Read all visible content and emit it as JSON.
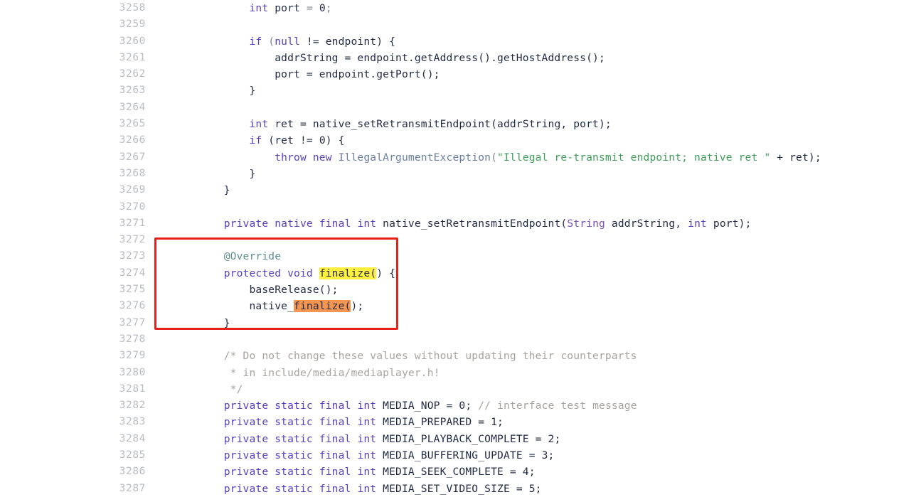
{
  "viewer": {
    "name": "code-file-viewer",
    "language": "Java",
    "first_line": 3258,
    "last_line": 3287
  },
  "annotation": {
    "type": "rectangle",
    "color": "#e8201a",
    "covers_lines": [
      3273,
      3277
    ],
    "label": "finalize-method-callout"
  },
  "highlights": [
    {
      "text": "finalize(",
      "color": "#ffef3f",
      "line": 3274,
      "name": "search-match-primary"
    },
    {
      "text": "finalize(",
      "color": "#f59552",
      "line": 3276,
      "name": "search-match-selected"
    }
  ],
  "colors": {
    "background": "#ffffff",
    "line_number": "#b9bdc4",
    "text": "#1f2a44",
    "keyword": "#5b3fbf",
    "type": "#7a4fbf",
    "class_name": "#6b7f9e",
    "string": "#3f9e5a",
    "comment": "#a8a49c",
    "annotation_token": "#5f8f92",
    "highlight_yellow": "#ffef3f",
    "highlight_orange": "#f59552",
    "callout_red": "#e8201a"
  },
  "lines": [
    {
      "number": "3258",
      "tokens": [
        {
          "t": "        ",
          "c": "plain"
        },
        {
          "t": "int",
          "c": "kw"
        },
        {
          "t": " port ",
          "c": "plain"
        },
        {
          "t": "=",
          "c": "punct"
        },
        {
          "t": " ",
          "c": "plain"
        },
        {
          "t": "0",
          "c": "num"
        },
        {
          "t": ";",
          "c": "punct"
        }
      ]
    },
    {
      "number": "3259",
      "tokens": []
    },
    {
      "number": "3260",
      "tokens": [
        {
          "t": "        ",
          "c": "plain"
        },
        {
          "t": "if",
          "c": "kw"
        },
        {
          "t": " (",
          "c": "punct"
        },
        {
          "t": "null",
          "c": "kw"
        },
        {
          "t": " != endpoint) {",
          "c": "plain"
        }
      ]
    },
    {
      "number": "3261",
      "tokens": [
        {
          "t": "            addrString = endpoint.getAddress().getHostAddress();",
          "c": "plain"
        }
      ]
    },
    {
      "number": "3262",
      "tokens": [
        {
          "t": "            port = endpoint.getPort();",
          "c": "plain"
        }
      ]
    },
    {
      "number": "3263",
      "tokens": [
        {
          "t": "        }",
          "c": "plain"
        }
      ]
    },
    {
      "number": "3264",
      "tokens": []
    },
    {
      "number": "3265",
      "tokens": [
        {
          "t": "        ",
          "c": "plain"
        },
        {
          "t": "int",
          "c": "kw"
        },
        {
          "t": " ret = native_setRetransmitEndpoint(addrString, port);",
          "c": "plain"
        }
      ]
    },
    {
      "number": "3266",
      "tokens": [
        {
          "t": "        ",
          "c": "plain"
        },
        {
          "t": "if",
          "c": "kw"
        },
        {
          "t": " (ret != ",
          "c": "plain"
        },
        {
          "t": "0",
          "c": "num"
        },
        {
          "t": ") {",
          "c": "plain"
        }
      ]
    },
    {
      "number": "3267",
      "tokens": [
        {
          "t": "            ",
          "c": "plain"
        },
        {
          "t": "throw",
          "c": "kw"
        },
        {
          "t": " ",
          "c": "plain"
        },
        {
          "t": "new",
          "c": "kw"
        },
        {
          "t": " ",
          "c": "plain"
        },
        {
          "t": "IllegalArgumentException",
          "c": "cls"
        },
        {
          "t": "(",
          "c": "punct"
        },
        {
          "t": "\"Illegal re-transmit endpoint; native ret \"",
          "c": "str"
        },
        {
          "t": " + ret);",
          "c": "plain"
        }
      ]
    },
    {
      "number": "3268",
      "tokens": [
        {
          "t": "        }",
          "c": "plain"
        }
      ]
    },
    {
      "number": "3269",
      "tokens": [
        {
          "t": "    }",
          "c": "plain"
        }
      ]
    },
    {
      "number": "3270",
      "tokens": []
    },
    {
      "number": "3271",
      "tokens": [
        {
          "t": "    ",
          "c": "plain"
        },
        {
          "t": "private",
          "c": "kw"
        },
        {
          "t": " ",
          "c": "plain"
        },
        {
          "t": "native",
          "c": "kw"
        },
        {
          "t": " ",
          "c": "plain"
        },
        {
          "t": "final",
          "c": "kw"
        },
        {
          "t": " ",
          "c": "plain"
        },
        {
          "t": "int",
          "c": "kw"
        },
        {
          "t": " native_setRetransmitEndpoint(",
          "c": "plain"
        },
        {
          "t": "String",
          "c": "type"
        },
        {
          "t": " addrString, ",
          "c": "plain"
        },
        {
          "t": "int",
          "c": "kw"
        },
        {
          "t": " port);",
          "c": "plain"
        }
      ]
    },
    {
      "number": "3272",
      "tokens": []
    },
    {
      "number": "3273",
      "tokens": [
        {
          "t": "    ",
          "c": "plain"
        },
        {
          "t": "@Override",
          "c": "anno"
        }
      ]
    },
    {
      "number": "3274",
      "tokens": [
        {
          "t": "    ",
          "c": "plain"
        },
        {
          "t": "protected",
          "c": "kw"
        },
        {
          "t": " ",
          "c": "plain"
        },
        {
          "t": "void",
          "c": "kw"
        },
        {
          "t": " ",
          "c": "plain"
        },
        {
          "t": "finalize(",
          "c": "plain",
          "hl": "yellow"
        },
        {
          "t": ") {",
          "c": "plain"
        }
      ]
    },
    {
      "number": "3275",
      "tokens": [
        {
          "t": "        baseRelease();",
          "c": "plain"
        }
      ]
    },
    {
      "number": "3276",
      "tokens": [
        {
          "t": "        native_",
          "c": "plain"
        },
        {
          "t": "finalize(",
          "c": "plain",
          "hl": "orange"
        },
        {
          "t": ");",
          "c": "plain"
        }
      ]
    },
    {
      "number": "3277",
      "tokens": [
        {
          "t": "    }",
          "c": "plain"
        }
      ]
    },
    {
      "number": "3278",
      "tokens": []
    },
    {
      "number": "3279",
      "tokens": [
        {
          "t": "    /* Do not change these values without updating their counterparts",
          "c": "comment"
        }
      ]
    },
    {
      "number": "3280",
      "tokens": [
        {
          "t": "     * in include/media/mediaplayer.h!",
          "c": "comment"
        }
      ]
    },
    {
      "number": "3281",
      "tokens": [
        {
          "t": "     */",
          "c": "comment"
        }
      ]
    },
    {
      "number": "3282",
      "tokens": [
        {
          "t": "    ",
          "c": "plain"
        },
        {
          "t": "private",
          "c": "kw"
        },
        {
          "t": " ",
          "c": "plain"
        },
        {
          "t": "static",
          "c": "kw"
        },
        {
          "t": " ",
          "c": "plain"
        },
        {
          "t": "final",
          "c": "kw"
        },
        {
          "t": " ",
          "c": "plain"
        },
        {
          "t": "int",
          "c": "kw"
        },
        {
          "t": " MEDIA_NOP = ",
          "c": "plain"
        },
        {
          "t": "0",
          "c": "num"
        },
        {
          "t": "; ",
          "c": "plain"
        },
        {
          "t": "// interface test message",
          "c": "comment"
        }
      ]
    },
    {
      "number": "3283",
      "tokens": [
        {
          "t": "    ",
          "c": "plain"
        },
        {
          "t": "private",
          "c": "kw"
        },
        {
          "t": " ",
          "c": "plain"
        },
        {
          "t": "static",
          "c": "kw"
        },
        {
          "t": " ",
          "c": "plain"
        },
        {
          "t": "final",
          "c": "kw"
        },
        {
          "t": " ",
          "c": "plain"
        },
        {
          "t": "int",
          "c": "kw"
        },
        {
          "t": " MEDIA_PREPARED = ",
          "c": "plain"
        },
        {
          "t": "1",
          "c": "num"
        },
        {
          "t": ";",
          "c": "plain"
        }
      ]
    },
    {
      "number": "3284",
      "tokens": [
        {
          "t": "    ",
          "c": "plain"
        },
        {
          "t": "private",
          "c": "kw"
        },
        {
          "t": " ",
          "c": "plain"
        },
        {
          "t": "static",
          "c": "kw"
        },
        {
          "t": " ",
          "c": "plain"
        },
        {
          "t": "final",
          "c": "kw"
        },
        {
          "t": " ",
          "c": "plain"
        },
        {
          "t": "int",
          "c": "kw"
        },
        {
          "t": " MEDIA_PLAYBACK_COMPLETE = ",
          "c": "plain"
        },
        {
          "t": "2",
          "c": "num"
        },
        {
          "t": ";",
          "c": "plain"
        }
      ]
    },
    {
      "number": "3285",
      "tokens": [
        {
          "t": "    ",
          "c": "plain"
        },
        {
          "t": "private",
          "c": "kw"
        },
        {
          "t": " ",
          "c": "plain"
        },
        {
          "t": "static",
          "c": "kw"
        },
        {
          "t": " ",
          "c": "plain"
        },
        {
          "t": "final",
          "c": "kw"
        },
        {
          "t": " ",
          "c": "plain"
        },
        {
          "t": "int",
          "c": "kw"
        },
        {
          "t": " MEDIA_BUFFERING_UPDATE = ",
          "c": "plain"
        },
        {
          "t": "3",
          "c": "num"
        },
        {
          "t": ";",
          "c": "plain"
        }
      ]
    },
    {
      "number": "3286",
      "tokens": [
        {
          "t": "    ",
          "c": "plain"
        },
        {
          "t": "private",
          "c": "kw"
        },
        {
          "t": " ",
          "c": "plain"
        },
        {
          "t": "static",
          "c": "kw"
        },
        {
          "t": " ",
          "c": "plain"
        },
        {
          "t": "final",
          "c": "kw"
        },
        {
          "t": " ",
          "c": "plain"
        },
        {
          "t": "int",
          "c": "kw"
        },
        {
          "t": " MEDIA_SEEK_COMPLETE = ",
          "c": "plain"
        },
        {
          "t": "4",
          "c": "num"
        },
        {
          "t": ";",
          "c": "plain"
        }
      ]
    },
    {
      "number": "3287",
      "tokens": [
        {
          "t": "    ",
          "c": "plain"
        },
        {
          "t": "private",
          "c": "kw"
        },
        {
          "t": " ",
          "c": "plain"
        },
        {
          "t": "static",
          "c": "kw"
        },
        {
          "t": " ",
          "c": "plain"
        },
        {
          "t": "final",
          "c": "kw"
        },
        {
          "t": " ",
          "c": "plain"
        },
        {
          "t": "int",
          "c": "kw"
        },
        {
          "t": " MEDIA_SET_VIDEO_SIZE = ",
          "c": "plain"
        },
        {
          "t": "5",
          "c": "num"
        },
        {
          "t": ";",
          "c": "plain"
        }
      ]
    }
  ]
}
